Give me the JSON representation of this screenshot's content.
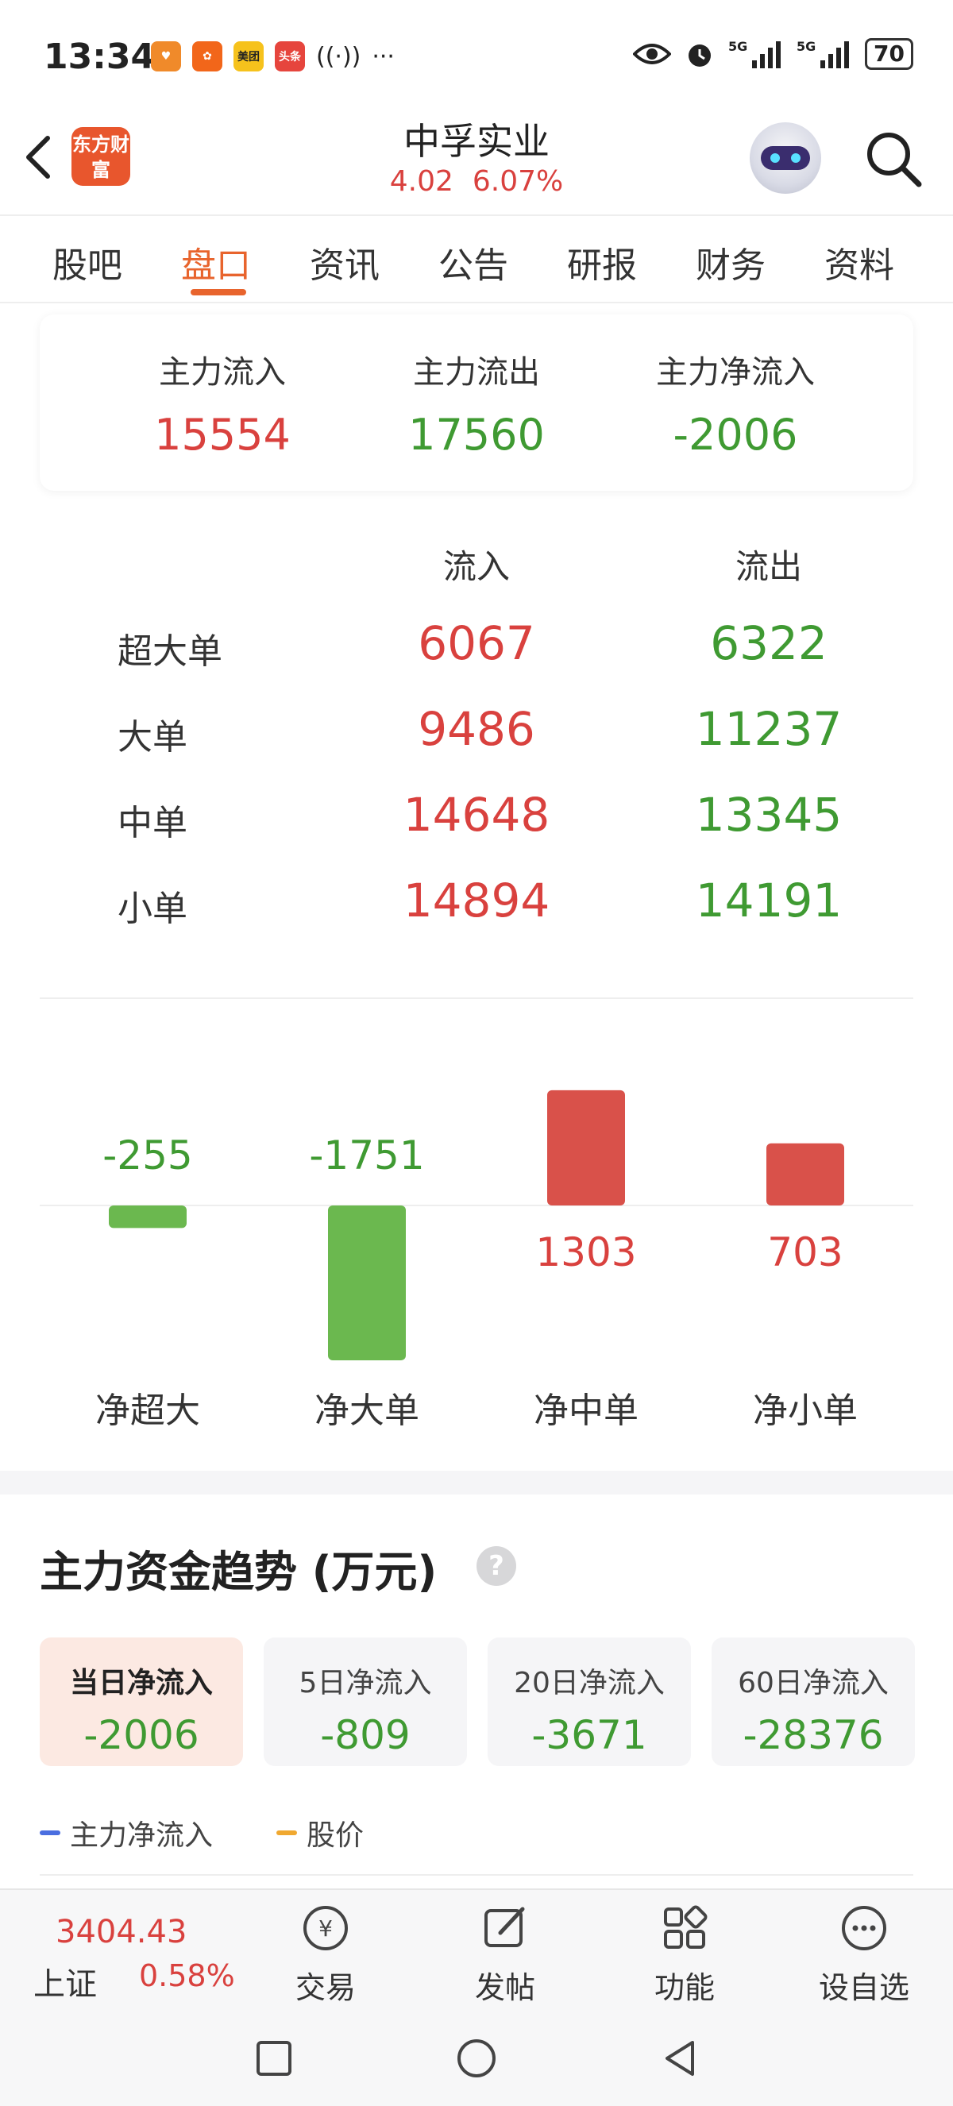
{
  "status_bar": {
    "time": "13:34",
    "notif_icons": [
      {
        "name": "taobao-app-icon",
        "color": "#f08a2a",
        "text": "♥"
      },
      {
        "name": "kuaishou-app-icon",
        "color": "#f2661a",
        "text": "✿"
      },
      {
        "name": "meituan-app-icon",
        "color": "#f6c21c",
        "text": "美团"
      },
      {
        "name": "toutiao-app-icon",
        "color": "#e6453d",
        "text": "头条"
      }
    ],
    "battery": "70"
  },
  "header": {
    "logo_text": "东方财富",
    "stock_name": "中孚实业",
    "price": "4.02",
    "change_pct": "6.07%"
  },
  "tabs": [
    "股吧",
    "盘口",
    "资讯",
    "公告",
    "研报",
    "财务",
    "资料"
  ],
  "active_tab": "盘口",
  "main_flow": {
    "items": [
      {
        "label": "主力流入",
        "value": "15554"
      },
      {
        "label": "主力流出",
        "value": "17560"
      },
      {
        "label": "主力净流入",
        "value": "-2006"
      }
    ]
  },
  "order_flow": {
    "head_in": "流入",
    "head_out": "流出",
    "rows": [
      {
        "name": "超大单",
        "in": "6067",
        "out": "6322"
      },
      {
        "name": "大单",
        "in": "9486",
        "out": "11237"
      },
      {
        "name": "中单",
        "in": "14648",
        "out": "13345"
      },
      {
        "name": "小单",
        "in": "14894",
        "out": "14191"
      }
    ]
  },
  "chart_data": {
    "type": "bar",
    "categories": [
      "净超大",
      "净大单",
      "净中单",
      "净小单"
    ],
    "values": [
      -255,
      -1751,
      1303,
      703
    ],
    "value_labels": [
      "-255",
      "-1751",
      "1303",
      "703"
    ],
    "colors": {
      "positive": "#d9514a",
      "negative": "#6bb84f"
    }
  },
  "trend": {
    "title": "主力资金趋势 (万元)",
    "help_icon": "?",
    "periods": [
      {
        "label": "当日净流入",
        "value": "-2006",
        "active": true
      },
      {
        "label": "5日净流入",
        "value": "-809",
        "active": false
      },
      {
        "label": "20日净流入",
        "value": "-3671",
        "active": false
      },
      {
        "label": "60日净流入",
        "value": "-28376",
        "active": false
      }
    ],
    "legend": [
      {
        "label": "主力净流入",
        "color": "#4a6ee0"
      },
      {
        "label": "股价",
        "color": "#f0a830"
      }
    ]
  },
  "toolbar": {
    "index_value": "3404.43",
    "index_name": "上证",
    "index_pct": "0.58%",
    "items": [
      {
        "label": "交易",
        "icon": "trade-icon"
      },
      {
        "label": "发帖",
        "icon": "post-icon"
      },
      {
        "label": "功能",
        "icon": "apps-icon"
      },
      {
        "label": "设自选",
        "icon": "more-icon"
      }
    ]
  }
}
